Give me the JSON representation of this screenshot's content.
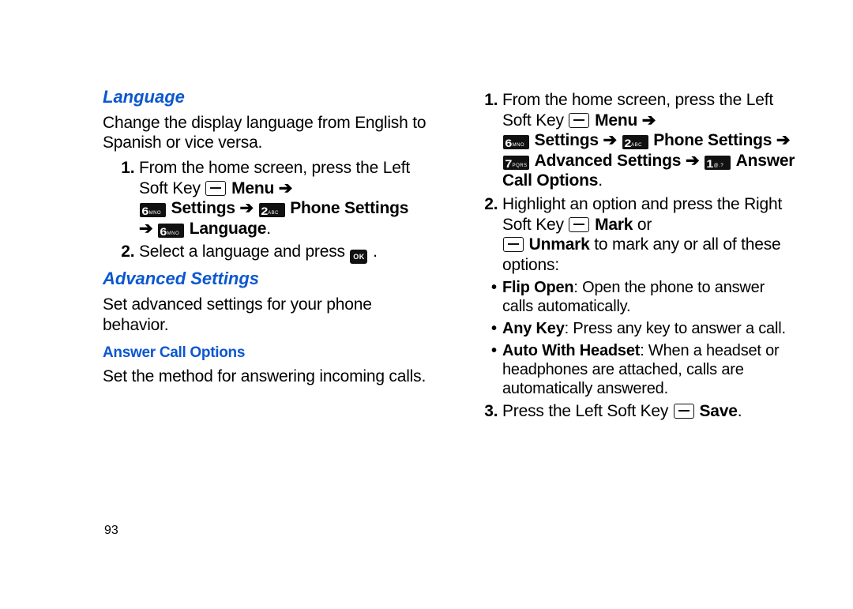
{
  "page_number": "93",
  "icons": {
    "softkey": "soft-key",
    "ok": "OK",
    "k1": {
      "d": "1",
      "s": "@.?"
    },
    "k2": {
      "d": "2",
      "s": "ABC"
    },
    "k6": {
      "d": "6",
      "s": "MNO"
    },
    "k7": {
      "d": "7",
      "s": "PQRS"
    }
  },
  "arrow": "➔",
  "left": {
    "language": {
      "title": "Language",
      "intro": "Change the display language from English to Spanish or vice versa.",
      "steps": {
        "s1a": "From the home screen, press the Left Soft Key ",
        "s1_menu": "Menu",
        "s1_settings": "Settings",
        "s1_phone": "Phone Settings",
        "s1_language": "Language",
        "s2a": "Select a language and press "
      }
    },
    "advanced": {
      "title": "Advanced Settings",
      "intro": "Set advanced settings for your phone behavior.",
      "answer": {
        "title": "Answer Call Options",
        "intro": "Set the method for answering incoming calls."
      }
    }
  },
  "right": {
    "steps": {
      "s1a": "From the home screen, press the Left Soft Key ",
      "s1_menu": "Menu",
      "s1_settings": "Settings",
      "s1_phone": "Phone Settings",
      "s1_adv": "Advanced Settings",
      "s1_aco": "Answer Call Options",
      "s2a": "Highlight an option and press the Right Soft Key ",
      "s2_mark": "Mark",
      "s2_or": " or ",
      "s2_unmark": "Unmark",
      "s2_tail": "  to mark any or all of these options:",
      "bullets": {
        "b1t": "Flip Open",
        "b1": ": Open the phone to answer calls automatically.",
        "b2t": "Any Key",
        "b2": ": Press any key to answer a call.",
        "b3t": "Auto With Headset",
        "b3": ": When a headset or headphones are attached, calls are automatically answered."
      },
      "s3a": "Press the Left Soft Key ",
      "s3_save": "Save"
    }
  }
}
